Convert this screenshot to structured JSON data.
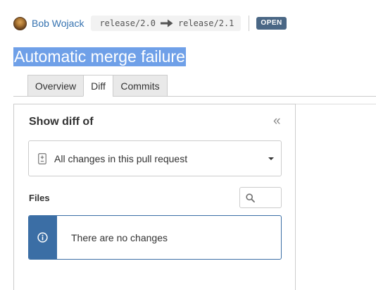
{
  "header": {
    "author": "Bob Wojack",
    "source_branch": "release/2.0",
    "target_branch": "release/2.1",
    "status": "OPEN",
    "avatar_icon": "avatar"
  },
  "title": "Automatic merge failure",
  "tabs": [
    {
      "label": "Overview",
      "active": false
    },
    {
      "label": "Diff",
      "active": true
    },
    {
      "label": "Commits",
      "active": false
    }
  ],
  "diff_panel": {
    "title": "Show diff of",
    "collapse_icon": "double-chevron-left-icon",
    "selector": {
      "selected": "All changes in this pull request",
      "icon": "diff-icon"
    },
    "files_label": "Files",
    "search_icon": "search-icon",
    "notice": {
      "text": "There are no changes",
      "icon": "info-icon"
    }
  },
  "colors": {
    "link": "#3572b0",
    "badge_bg": "#4a6785",
    "title_highlight": "#6fa0e8",
    "notice_accent": "#3b6ea5"
  }
}
